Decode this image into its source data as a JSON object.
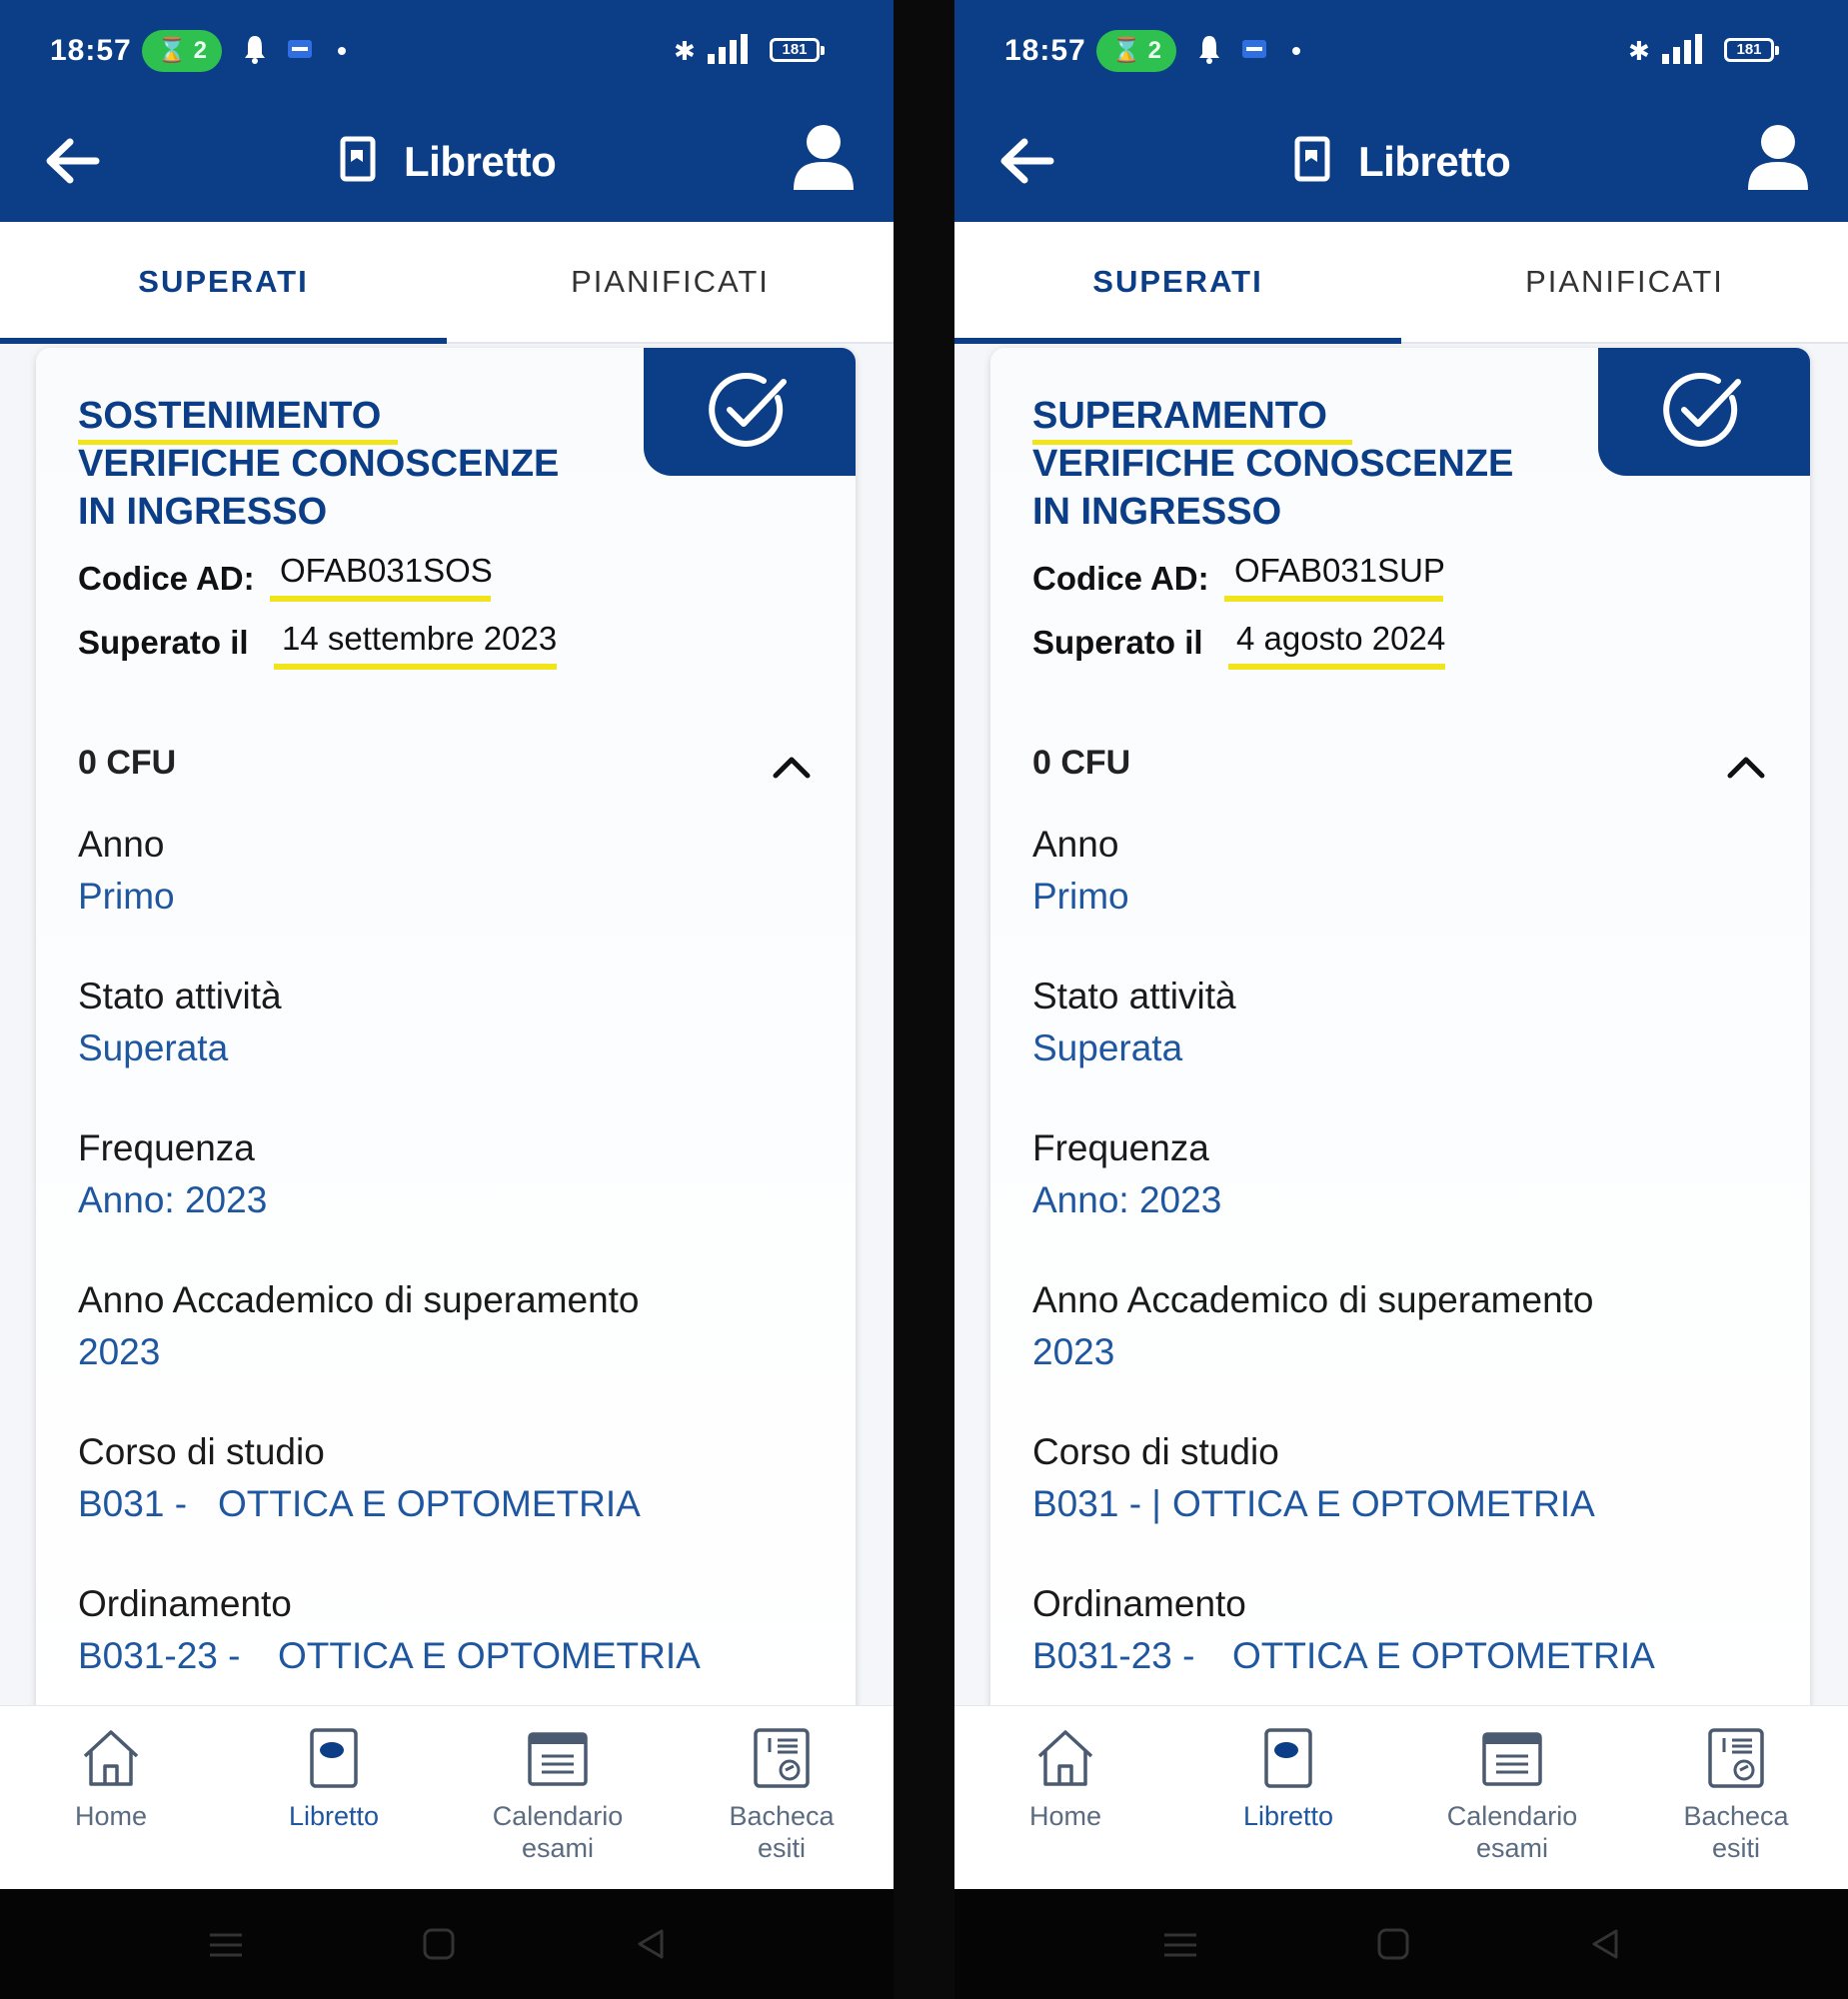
{
  "screens": [
    {
      "status": {
        "time": "18:57",
        "pill": "⌛ 2",
        "bt": "✱",
        "battery": "181"
      },
      "appbar": {
        "title": "Libretto"
      },
      "tabs": {
        "superati": "SUPERATI",
        "pianificati": "PIANIFICATI"
      },
      "card": {
        "title_lines": [
          "SOSTENIMENTO",
          "VERIFICHE CONOSCENZE",
          "IN INGRESSO"
        ],
        "codice_label": "Codice AD:",
        "codice_value": "OFAB031SOS",
        "superato_label": "Superato il",
        "superato_value": "14 settembre 2023",
        "cfu": "0 CFU",
        "fields": {
          "anno_label": "Anno",
          "anno_value": "Primo",
          "stato_label": "Stato attività",
          "stato_value": "Superata",
          "frequenza_label": "Frequenza",
          "frequenza_value": "Anno: 2023",
          "aa_label": "Anno Accademico di superamento",
          "aa_value": "2023",
          "corso_label": "Corso di studio",
          "corso_code": "B031 -",
          "corso_name": "OTTICA E OPTOMETRIA",
          "ord_label": "Ordinamento",
          "ord_code": "B031-23 -",
          "ord_name": "OTTICA E OPTOMETRIA"
        }
      },
      "nav": {
        "home": "Home",
        "libretto": "Libretto",
        "calendario_1": "Calendario",
        "calendario_2": "esami",
        "bacheca_1": "Bacheca",
        "bacheca_2": "esiti"
      }
    },
    {
      "status": {
        "time": "18:57",
        "pill": "⌛ 2",
        "bt": "✱",
        "battery": "181"
      },
      "appbar": {
        "title": "Libretto"
      },
      "tabs": {
        "superati": "SUPERATI",
        "pianificati": "PIANIFICATI"
      },
      "card": {
        "title_lines": [
          "SUPERAMENTO",
          "VERIFICHE CONOSCENZE",
          "IN INGRESSO"
        ],
        "codice_label": "Codice AD:",
        "codice_value": "OFAB031SUP",
        "superato_label": "Superato il",
        "superato_value": "4 agosto 2024",
        "cfu": "0 CFU",
        "fields": {
          "anno_label": "Anno",
          "anno_value": "Primo",
          "stato_label": "Stato attività",
          "stato_value": "Superata",
          "frequenza_label": "Frequenza",
          "frequenza_value": "Anno: 2023",
          "aa_label": "Anno Accademico di superamento",
          "aa_value": "2023",
          "corso_label": "Corso di studio",
          "corso_code": "B031 - |",
          "corso_name": "OTTICA E OPTOMETRIA",
          "ord_label": "Ordinamento",
          "ord_code": "B031-23 -",
          "ord_name": "OTTICA E OPTOMETRIA"
        }
      },
      "nav": {
        "home": "Home",
        "libretto": "Libretto",
        "calendario_1": "Calendario",
        "calendario_2": "esami",
        "bacheca_1": "Bacheca",
        "bacheca_2": "esiti"
      }
    }
  ],
  "colors": {
    "primary": "#0b3e86",
    "link": "#1e56a0",
    "highlight": "#f2e41a",
    "pill": "#2ec14f"
  }
}
